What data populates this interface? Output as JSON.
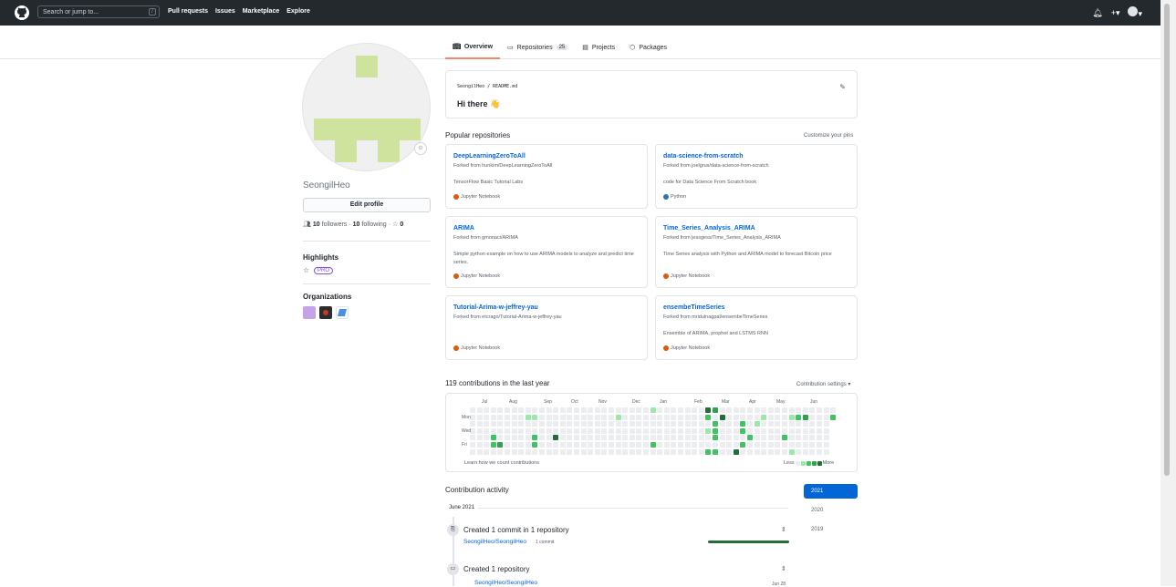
{
  "header": {
    "search_placeholder": "Search or jump to...",
    "slash_key": "/",
    "nav": [
      "Pull requests",
      "Issues",
      "Marketplace",
      "Explore"
    ],
    "icons": [
      "bell-icon",
      "plus-icon",
      "avatar-icon"
    ]
  },
  "tabs": [
    {
      "label": "Overview",
      "icon": "book-icon",
      "active": true
    },
    {
      "label": "Repositories",
      "icon": "repo-icon",
      "count": "25"
    },
    {
      "label": "Projects",
      "icon": "project-icon"
    },
    {
      "label": "Packages",
      "icon": "package-icon"
    }
  ],
  "profile": {
    "username": "SeongilHeo",
    "edit_label": "Edit profile",
    "followers_count": "10",
    "followers_label": "followers",
    "following_count": "10",
    "following_label": "following",
    "stars_count": "0",
    "highlights_title": "Highlights",
    "pro_badge": "PRO",
    "orgs_title": "Organizations",
    "avatar_color": "#d0e39e"
  },
  "readme": {
    "path": "SeongilHeo / README.md",
    "greeting": "Hi there 👋"
  },
  "popular": {
    "title": "Popular repositories",
    "customize": "Customize your pins",
    "cards": [
      {
        "name": "DeepLearningZeroToAll",
        "fork": "Forked from hunkim/DeepLearningZeroToAll",
        "desc": "TensorFlow Basic Tutorial Labs",
        "lang": "Jupyter Notebook",
        "color": "#DA5B0B"
      },
      {
        "name": "data-science-from-scratch",
        "fork": "Forked from joelgrus/data-science-from-scratch",
        "desc": "code for Data Science From Scratch book",
        "lang": "Python",
        "color": "#3572A5"
      },
      {
        "name": "ARIMA",
        "fork": "Forked from gmonaci/ARIMA",
        "desc": "Simple python example on how to use ARIMA models to analyze and predict time series.",
        "lang": "Jupyter Notebook",
        "color": "#DA5B0B"
      },
      {
        "name": "Time_Series_Analysis_ARIMA",
        "fork": "Forked from jessgess/Time_Series_Analysis_ARIMA",
        "desc": "Time Series analysis with Python and ARIMA model to forecast Bitcoin price",
        "lang": "Jupyter Notebook",
        "color": "#DA5B0B"
      },
      {
        "name": "Tutorial-Arima-w-jeffrey-yau",
        "fork": "Forked from etcrago/Tutorial-Arima-w-jeffrey-yau",
        "desc": "",
        "lang": "Jupyter Notebook",
        "color": "#DA5B0B"
      },
      {
        "name": "ensembeTimeSeries",
        "fork": "Forked from mridulnagpal/ensembeTimeSeries",
        "desc": "Ensemble of ARIMA, prophet and LSTMS RNN",
        "lang": "Jupyter Notebook",
        "color": "#DA5B0B"
      }
    ]
  },
  "contributions": {
    "title": "119 contributions in the last year",
    "settings": "Contribution settings ▾",
    "months": [
      "Jul",
      "Aug",
      "Sep",
      "Oct",
      "Nov",
      "Dec",
      "Jan",
      "Feb",
      "Mar",
      "Apr",
      "May",
      "Jun"
    ],
    "days": [
      "Mon",
      "Wed",
      "Fri"
    ],
    "learn": "Learn how we count contributions",
    "less": "Less",
    "more": "More",
    "level_colors": [
      "#ebedf0",
      "#9be9a8",
      "#40c463",
      "#30a14e",
      "#216e39"
    ]
  },
  "activity": {
    "title": "Contribution activity",
    "years": [
      "2021",
      "2020",
      "2019"
    ],
    "month_header": "June 2021",
    "items": [
      {
        "text": "Created 1 commit in 1 repository",
        "link": "SeongilHeo/SeongilHeo",
        "sub": "1 commit"
      },
      {
        "text": "Created 1 repository",
        "link": "SeongilHeo/SeongilHeo",
        "sub": "Jun 28"
      }
    ]
  }
}
